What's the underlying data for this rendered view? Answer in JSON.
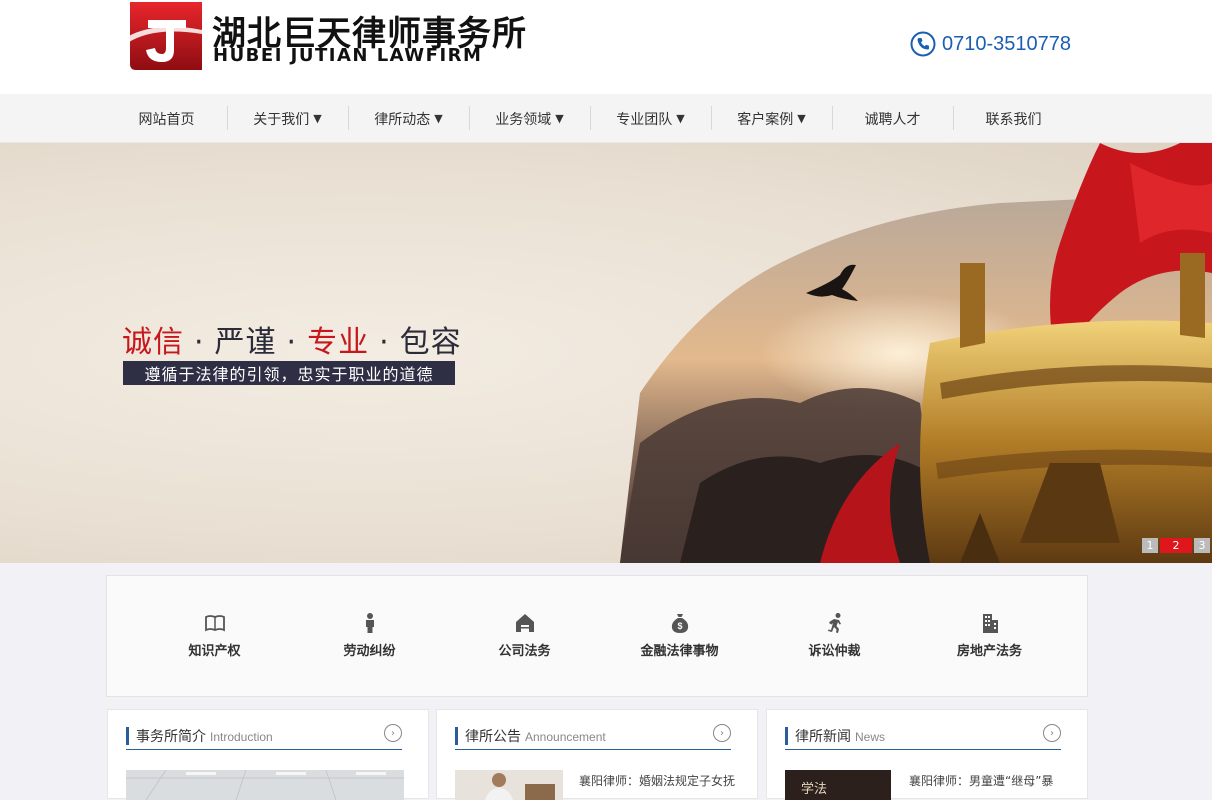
{
  "header": {
    "logo_cn": "湖北巨天律师事务所",
    "logo_en": "HUBEI JUTIAN LAWFIRM",
    "phone": "0710-3510778"
  },
  "nav": {
    "items": [
      {
        "label": "网站首页",
        "caret": ""
      },
      {
        "label": "关于我们",
        "caret": "▼"
      },
      {
        "label": "律所动态",
        "caret": "▼"
      },
      {
        "label": "业务领域",
        "caret": "▼"
      },
      {
        "label": "专业团队",
        "caret": "▼"
      },
      {
        "label": "客户案例",
        "caret": "▼"
      },
      {
        "label": "诚聘人才",
        "caret": ""
      },
      {
        "label": "联系我们",
        "caret": ""
      }
    ]
  },
  "banner": {
    "slogan": {
      "w1": "诚信",
      "w2": "严谨",
      "w3": "专业",
      "w4": "包容",
      "dot": "·"
    },
    "subtitle": "遵循于法律的引领，忠实于职业的道德",
    "pager": [
      "1",
      "2",
      "3"
    ],
    "active_page": "2"
  },
  "services": [
    {
      "label": "知识产权",
      "icon": "book-icon"
    },
    {
      "label": "劳动纠纷",
      "icon": "person-icon"
    },
    {
      "label": "公司法务",
      "icon": "house-icon"
    },
    {
      "label": "金融法律事物",
      "icon": "money-bag-icon"
    },
    {
      "label": "诉讼仲裁",
      "icon": "running-icon"
    },
    {
      "label": "房地产法务",
      "icon": "building-icon"
    }
  ],
  "panels": {
    "intro": {
      "title": "事务所简介",
      "title_en": "Introduction",
      "more": "›"
    },
    "announce": {
      "title": "律所公告",
      "title_en": "Announcement",
      "more": "›",
      "item": "襄阳律师：婚姻法规定子女抚"
    },
    "news": {
      "title": "律所新闻",
      "title_en": "News",
      "more": "›",
      "item": "襄阳律师：男童遭“继母”暴",
      "thumb_text": "学法"
    }
  },
  "colors": {
    "brand_red": "#c8161d",
    "brand_blue": "#2a5d9c",
    "phone_blue": "#1a5fb4"
  }
}
